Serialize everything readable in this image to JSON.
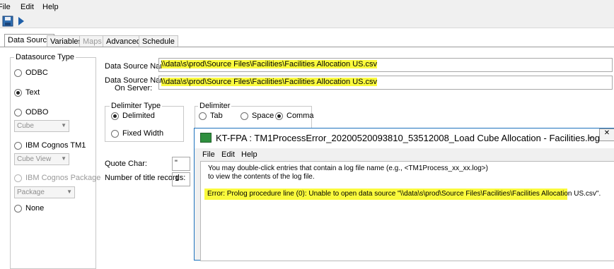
{
  "menu": {
    "file": "File",
    "edit": "Edit",
    "help": "Help"
  },
  "toolbar": {
    "save_icon": "save-icon",
    "run_icon": "run-icon"
  },
  "tabs": [
    "Data Source",
    "Variables",
    "Maps",
    "Advanced",
    "Schedule"
  ],
  "datasource_type": {
    "title": "Datasource Type",
    "odbc": "ODBC",
    "text": "Text",
    "odbo": "ODBO",
    "odbo_combo": "Cube",
    "tm1": "IBM Cognos TM1",
    "tm1_combo": "Cube View",
    "package": "IBM Cognos Package",
    "package_combo": "Package",
    "none": "None",
    "selected": "Text"
  },
  "fields": {
    "ds_name_label": "Data Source Name:",
    "ds_name_value": "\\\\data\\s\\prod\\Source Files\\Facilities\\Facilities Allocation US.csv",
    "ds_server_label_1": "Data Source Name",
    "ds_server_label_2": "On Server:",
    "ds_server_value": "\\\\data\\s\\prod\\Source Files\\Facilities\\Facilities Allocation US.csv",
    "quote_label": "Quote Char:",
    "quote_value": "\"",
    "title_records_label": "Number of title records:",
    "title_records_value": "1"
  },
  "delimiter_type": {
    "title": "Delimiter Type",
    "delimited": "Delimited",
    "fixed": "Fixed Width",
    "selected": "Delimited"
  },
  "delimiter": {
    "title": "Delimiter",
    "tab": "Tab",
    "space": "Space",
    "comma": "Comma",
    "selected": "Comma"
  },
  "log_window": {
    "title": "KT-FPA : TM1ProcessError_20200520093810_53512008_Load Cube Allocation - Facilities.log",
    "menu": {
      "file": "File",
      "edit": "Edit",
      "help": "Help"
    },
    "info_line1": "You may double-click entries that contain a log file name (e.g., <TM1Process_xx_xx.log>)",
    "info_line2": " to view the contents of the log file.",
    "error": "Error: Prolog procedure line (0): Unable to open data source \"\\\\data\\s\\prod\\Source Files\\Facilities\\Facilities Allocation US.csv\".",
    "minimize_label": "_",
    "close_label": "✕"
  },
  "colors": {
    "highlight": "#fafa3c",
    "window_border": "#1e73be"
  }
}
